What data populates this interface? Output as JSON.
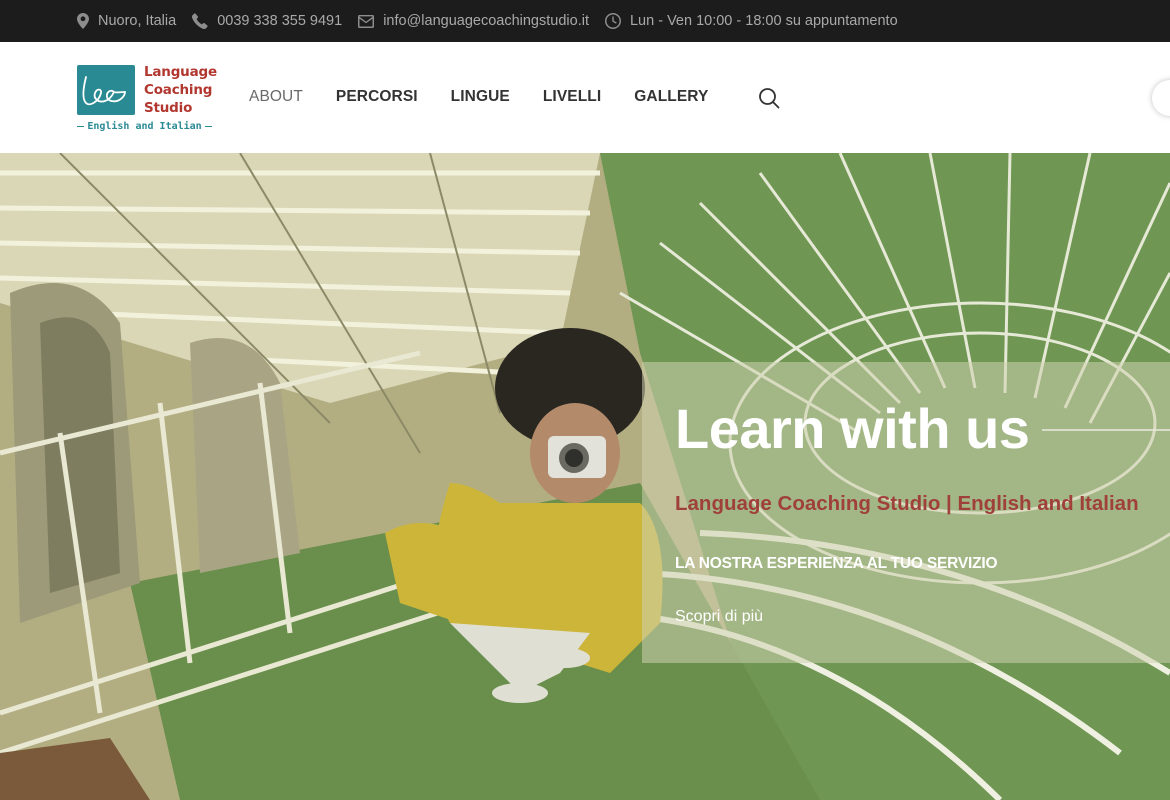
{
  "topbar": {
    "location": "Nuoro, Italia",
    "phone": "0039 338 355 9491",
    "email": "info@languagecoachingstudio.it",
    "hours": "Lun - Ven 10:00 - 18:00 su appuntamento"
  },
  "logo": {
    "line1": "Language",
    "line2": "Coaching",
    "line3": "Studio",
    "tagline": "English and Italian",
    "mark_color": "#2a8a94",
    "text_color": "#b2372f"
  },
  "nav": {
    "items": [
      "ABOUT",
      "PERCORSI",
      "LINGUE",
      "LIVELLI",
      "GALLERY"
    ],
    "search_icon": "search-icon"
  },
  "hero": {
    "title": "Learn with us",
    "subtitle": "Language Coaching Studio | English and Italian",
    "tagline": "LA NOSTRA ESPERIENZA AL TUO SERVIZIO",
    "link": "Scopri di più",
    "accent_color": "#a0403a"
  }
}
